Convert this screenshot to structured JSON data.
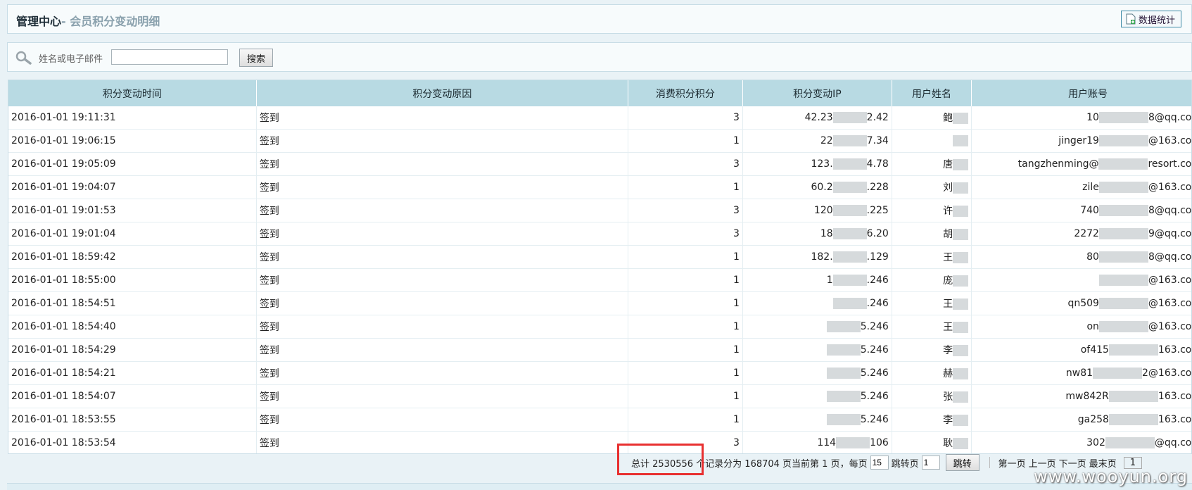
{
  "header": {
    "title": "管理中心",
    "subtitle": "- 会员积分变动明细",
    "stats_button": "数据统计"
  },
  "search": {
    "label": "姓名或电子邮件",
    "value": "",
    "button": "搜索"
  },
  "table": {
    "columns": [
      "积分变动时间",
      "积分变动原因",
      "消费积分积分",
      "积分变动IP",
      "用户姓名",
      "用户账号"
    ],
    "rows": [
      {
        "time": "2016-01-01 19:11:31",
        "reason": "签到",
        "points": "3",
        "ip": "42.23",
        "ip_tail": "2.42",
        "name": "鲍",
        "account": "10",
        "account_tail": "8@qq.com"
      },
      {
        "time": "2016-01-01 19:06:15",
        "reason": "签到",
        "points": "1",
        "ip": "22",
        "ip_tail": "7.34",
        "name": "",
        "account": "jinger19",
        "account_tail": "@163.com"
      },
      {
        "time": "2016-01-01 19:05:09",
        "reason": "签到",
        "points": "3",
        "ip": "123.",
        "ip_tail": "4.78",
        "name": "唐",
        "account": "tangzhenming@",
        "account_tail": "resort.com"
      },
      {
        "time": "2016-01-01 19:04:07",
        "reason": "签到",
        "points": "1",
        "ip": "60.2",
        "ip_tail": ".228",
        "name": "刘",
        "account": "zile",
        "account_tail": "@163.com"
      },
      {
        "time": "2016-01-01 19:01:53",
        "reason": "签到",
        "points": "3",
        "ip": "120",
        "ip_tail": ".225",
        "name": "许",
        "account": "740",
        "account_tail": "8@qq.com"
      },
      {
        "time": "2016-01-01 19:01:04",
        "reason": "签到",
        "points": "3",
        "ip": "18",
        "ip_tail": "6.20",
        "name": "胡",
        "account": "2272",
        "account_tail": "9@qq.com"
      },
      {
        "time": "2016-01-01 18:59:42",
        "reason": "签到",
        "points": "1",
        "ip": "182.",
        "ip_tail": ".129",
        "name": "王",
        "account": "80",
        "account_tail": "8@qq.com"
      },
      {
        "time": "2016-01-01 18:55:00",
        "reason": "签到",
        "points": "1",
        "ip": "1",
        "ip_tail": ".246",
        "name": "庞",
        "account": "",
        "account_tail": "@163.com"
      },
      {
        "time": "2016-01-01 18:54:51",
        "reason": "签到",
        "points": "1",
        "ip": "",
        "ip_tail": ".246",
        "name": "王",
        "account": "qn509",
        "account_tail": "@163.com"
      },
      {
        "time": "2016-01-01 18:54:40",
        "reason": "签到",
        "points": "1",
        "ip": "",
        "ip_tail": "5.246",
        "name": "王",
        "account": "on",
        "account_tail": "@163.com"
      },
      {
        "time": "2016-01-01 18:54:29",
        "reason": "签到",
        "points": "1",
        "ip": "",
        "ip_tail": "5.246",
        "name": "李",
        "account": "of415",
        "account_tail": "163.com"
      },
      {
        "time": "2016-01-01 18:54:21",
        "reason": "签到",
        "points": "1",
        "ip": "",
        "ip_tail": "5.246",
        "name": "赫",
        "account": "nw81",
        "account_tail": "2@163.com"
      },
      {
        "time": "2016-01-01 18:54:07",
        "reason": "签到",
        "points": "1",
        "ip": "",
        "ip_tail": "5.246",
        "name": "张",
        "account": "mw842R",
        "account_tail": "163.com"
      },
      {
        "time": "2016-01-01 18:53:55",
        "reason": "签到",
        "points": "1",
        "ip": "",
        "ip_tail": "5.246",
        "name": "李",
        "account": "ga258",
        "account_tail": "163.com"
      },
      {
        "time": "2016-01-01 18:53:54",
        "reason": "签到",
        "points": "3",
        "ip": "114",
        "ip_tail": "106",
        "name": "耿",
        "account": "302",
        "account_tail": "@qq.com"
      }
    ]
  },
  "pager": {
    "total_label": "总计 2530556 个记录分为 168704 页当前第 1 页，每页",
    "per_page": "15",
    "jump_label": "跳转页",
    "jump_page": "1",
    "jump_button": "跳转",
    "first": "第一页",
    "prev": "上一页",
    "next": "下一页",
    "last": "最末页",
    "page_select": "1"
  },
  "watermark": "www.wooyun.org",
  "colors": {
    "header_bg": "#b8dae3",
    "highlight": "#e83030"
  }
}
